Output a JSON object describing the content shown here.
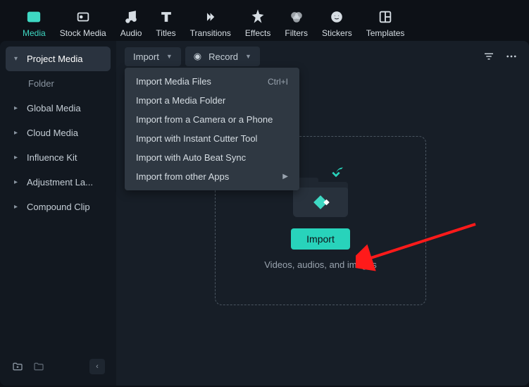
{
  "tabs": {
    "media": "Media",
    "stock": "Stock Media",
    "audio": "Audio",
    "titles": "Titles",
    "transitions": "Transitions",
    "effects": "Effects",
    "filters": "Filters",
    "stickers": "Stickers",
    "templates": "Templates"
  },
  "sidebar": {
    "project_media": "Project Media",
    "folder": "Folder",
    "global_media": "Global Media",
    "cloud_media": "Cloud Media",
    "influence_kit": "Influence Kit",
    "adjustment": "Adjustment La...",
    "compound": "Compound Clip"
  },
  "toolbar": {
    "import": "Import",
    "record": "Record"
  },
  "dropdown": {
    "import_files": "Import Media Files",
    "import_files_shortcut": "Ctrl+I",
    "import_folder": "Import a Media Folder",
    "import_camera": "Import from a Camera or a Phone",
    "import_cutter": "Import with Instant Cutter Tool",
    "import_beat": "Import with Auto Beat Sync",
    "import_other": "Import from other Apps"
  },
  "dropzone": {
    "button": "Import",
    "hint": "Videos, audios, and images"
  }
}
